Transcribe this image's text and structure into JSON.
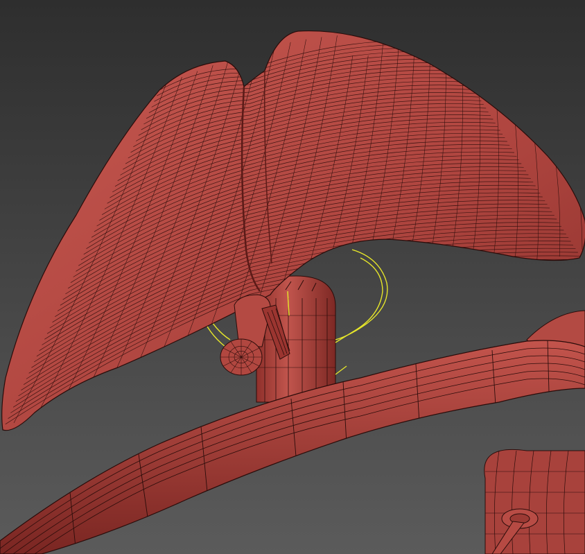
{
  "viewport": {
    "background_top": "#2e2e2e",
    "background_bottom": "#5b5b5b",
    "model_color": "#b34a43",
    "model_dark": "#7a2622",
    "wire_color": "#2a0c0a",
    "selection_color": "#e6e62a"
  }
}
